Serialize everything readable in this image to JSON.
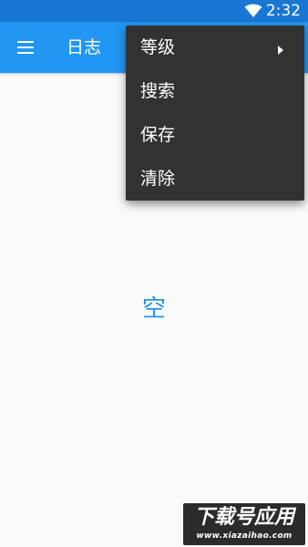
{
  "status_bar": {
    "time": "2:32",
    "wifi_icon": "wifi-icon"
  },
  "toolbar": {
    "menu_icon": "hamburger-menu-icon",
    "title": "日志"
  },
  "main": {
    "empty_text": "空"
  },
  "popup_menu": {
    "items": [
      {
        "label": "等级",
        "has_submenu": true,
        "submenu_icon": "submenu-arrow-icon"
      },
      {
        "label": "搜索",
        "has_submenu": false
      },
      {
        "label": "保存",
        "has_submenu": false
      },
      {
        "label": "清除",
        "has_submenu": false
      }
    ]
  },
  "watermark": {
    "title": "下载号应用",
    "url": "www.xiazaihao.com"
  },
  "colors": {
    "status_bar": "#1976d2",
    "toolbar": "#2196f3",
    "background": "#fafafa",
    "menu_background": "#323232",
    "empty_text": "#2196f3"
  }
}
